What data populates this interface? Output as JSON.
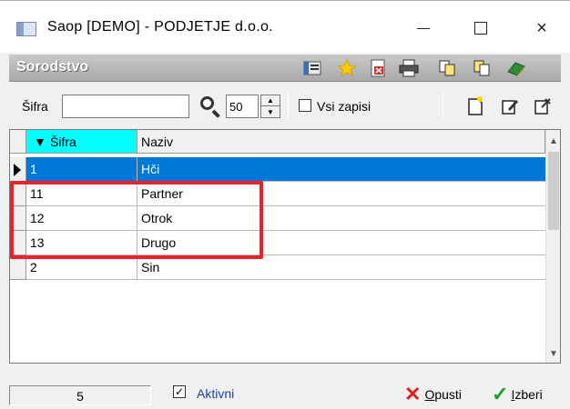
{
  "window": {
    "title": "Saop  [DEMO] - PODJETJE d.o.o.",
    "controls": {
      "minimize": "minimize",
      "maximize": "maximize",
      "close": "×"
    }
  },
  "header": {
    "title": "Sorodstvo",
    "toolbar_icons": [
      "organizer-icon",
      "star-icon",
      "excel-export-icon",
      "print-icon",
      "copy-records-icon",
      "paste-records-icon",
      "exit-book-icon"
    ]
  },
  "search": {
    "label": "Šifra",
    "value": "",
    "count_value": "50",
    "vsi_zapisi_label": "Vsi zapisi",
    "vsi_zapisi_checked": false
  },
  "grid": {
    "columns": [
      {
        "label": "Šifra",
        "sorted": true
      },
      {
        "label": "Naziv"
      }
    ],
    "sort_glyph": "▼",
    "rows": [
      {
        "sifra": "1",
        "naziv": "Hči",
        "selected": true
      },
      {
        "sifra": "11",
        "naziv": "Partner"
      },
      {
        "sifra": "12",
        "naziv": "Otrok"
      },
      {
        "sifra": "13",
        "naziv": "Drugo"
      },
      {
        "sifra": "2",
        "naziv": "Sin"
      }
    ]
  },
  "footer": {
    "record_count": "5",
    "aktivni_label": "Aktivni",
    "aktivni_checked": true,
    "opusti_label_first": "O",
    "opusti_label_rest": "pusti",
    "izberi_label_first": "I",
    "izberi_label_rest": "zberi"
  },
  "colors": {
    "selected_row": "#0078d7",
    "sorted_header": "#00ffff",
    "highlight_box": "#e8232a",
    "aktivni_text": "#1a3fbf"
  }
}
